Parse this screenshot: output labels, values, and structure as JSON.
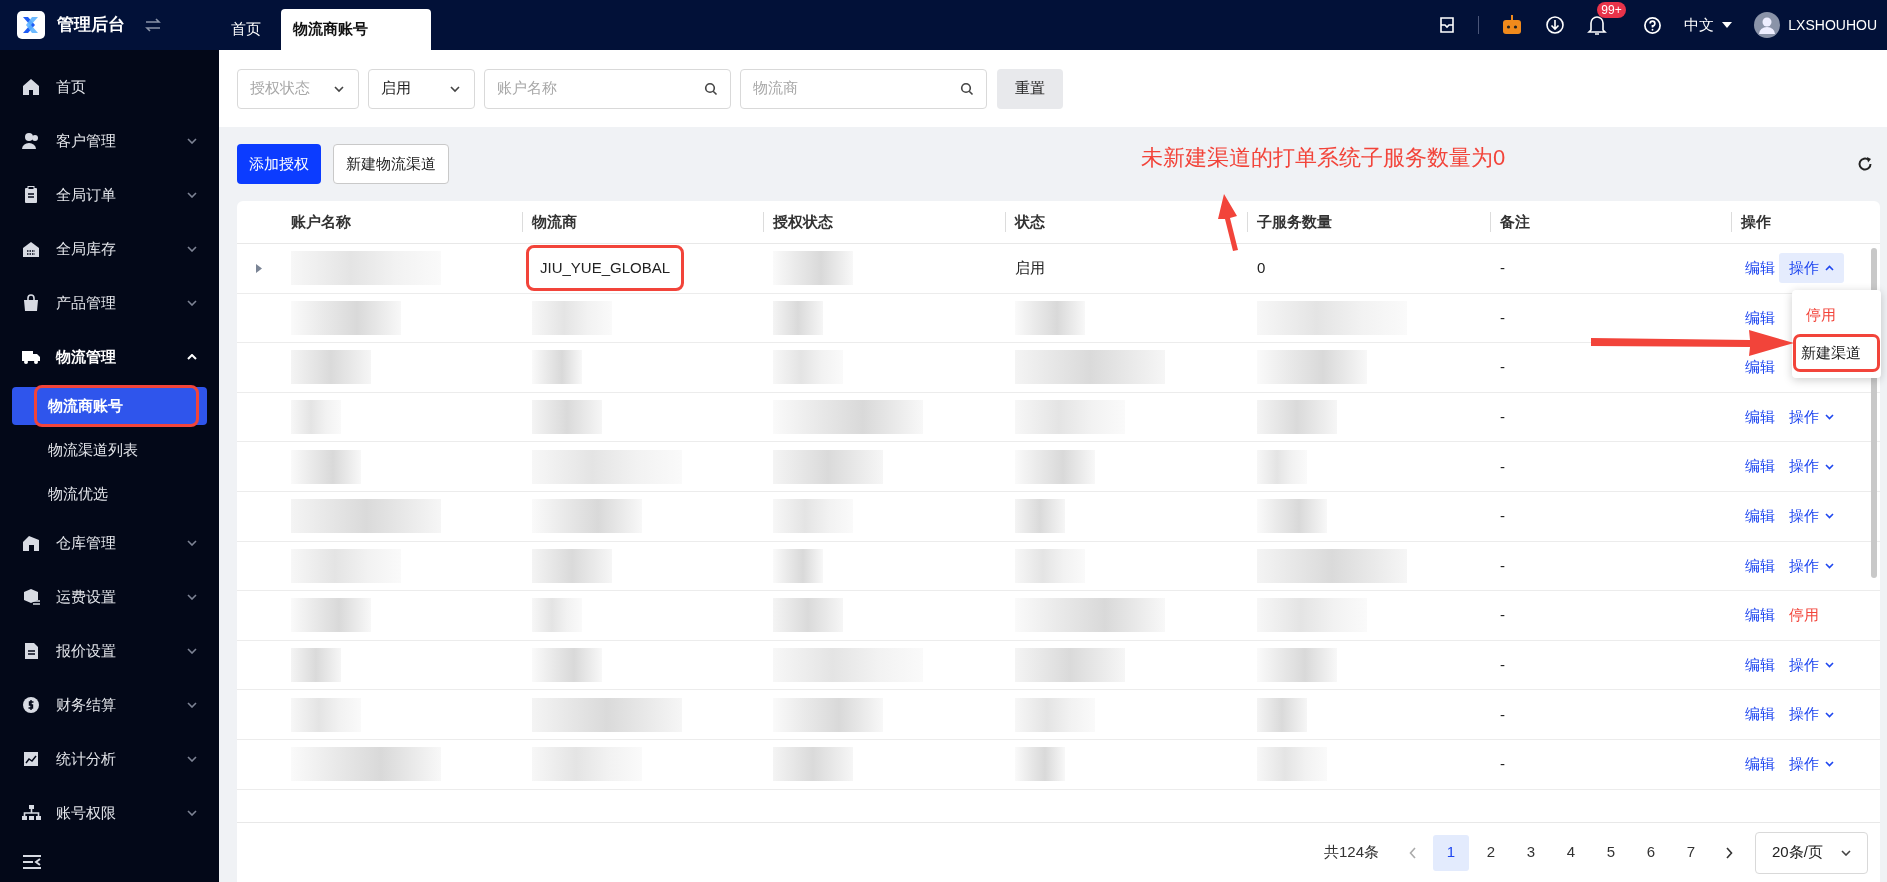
{
  "app_title": "管理后台",
  "top_tabs": [
    {
      "label": "首页",
      "selected": false
    },
    {
      "label": "物流商账号",
      "selected": true
    }
  ],
  "header": {
    "notification_badge": "99+",
    "language": "中文",
    "user": "LXSHOUHOU"
  },
  "sidebar": {
    "items": [
      {
        "kind": "link",
        "label": "首页"
      },
      {
        "kind": "group",
        "label": "客户管理",
        "expanded": false
      },
      {
        "kind": "group",
        "label": "全局订单",
        "expanded": false
      },
      {
        "kind": "group",
        "label": "全局库存",
        "expanded": false
      },
      {
        "kind": "group",
        "label": "产品管理",
        "expanded": false
      },
      {
        "kind": "group",
        "label": "物流管理",
        "expanded": true,
        "children": [
          {
            "label": "物流商账号",
            "selected": true,
            "highlighted": true
          },
          {
            "label": "物流渠道列表",
            "selected": false,
            "highlighted": false
          },
          {
            "label": "物流优选",
            "selected": false,
            "highlighted": false
          }
        ]
      },
      {
        "kind": "group",
        "label": "仓库管理",
        "expanded": false
      },
      {
        "kind": "group",
        "label": "运费设置",
        "expanded": false
      },
      {
        "kind": "group",
        "label": "报价设置",
        "expanded": false
      },
      {
        "kind": "group",
        "label": "财务结算",
        "expanded": false
      },
      {
        "kind": "group",
        "label": "统计分析",
        "expanded": false
      },
      {
        "kind": "group",
        "label": "账号权限",
        "expanded": false
      }
    ]
  },
  "filters": [
    {
      "kind": "select",
      "placeholder": "授权状态"
    },
    {
      "kind": "select",
      "value": "启用"
    },
    {
      "kind": "search",
      "placeholder": "账户名称"
    },
    {
      "kind": "search",
      "placeholder": "物流商"
    }
  ],
  "reset_button": "重置",
  "toolbar_buttons": [
    {
      "label": "添加授权",
      "primary": true
    },
    {
      "label": "新建物流渠道",
      "primary": false
    }
  ],
  "annotation": {
    "text": "未新建渠道的打单系统子服务数量为0"
  },
  "table": {
    "columns": [
      "账户名称",
      "物流商",
      "授权状态",
      "状态",
      "子服务数量",
      "备注",
      "操作"
    ],
    "rows": [
      {
        "expandable": true,
        "cells": [
          {
            "kind": "blurred"
          },
          {
            "kind": "text",
            "text": "JIU_YUE_GLOBAL",
            "highlighted": true
          },
          {
            "kind": "blurred"
          },
          {
            "kind": "text",
            "text": "启用"
          },
          {
            "kind": "text",
            "text": "0"
          }
        ],
        "remark": "-",
        "actions": [
          {
            "kind": "link",
            "label": "编辑"
          },
          {
            "kind": "menu",
            "label": "操作",
            "expanded": true
          }
        ]
      },
      {
        "expandable": false,
        "cells": [
          {
            "kind": "blurred"
          },
          {
            "kind": "blurred"
          },
          {
            "kind": "blurred"
          },
          {
            "kind": "blurred"
          },
          {
            "kind": "blurred"
          }
        ],
        "remark": "-",
        "actions": [
          {
            "kind": "link",
            "label": "编辑"
          }
        ]
      },
      {
        "expandable": false,
        "cells": [
          {
            "kind": "blurred"
          },
          {
            "kind": "blurred"
          },
          {
            "kind": "blurred"
          },
          {
            "kind": "blurred"
          },
          {
            "kind": "blurred"
          }
        ],
        "remark": "-",
        "actions": [
          {
            "kind": "link",
            "label": "编辑"
          }
        ]
      },
      {
        "expandable": false,
        "cells": [
          {
            "kind": "blurred"
          },
          {
            "kind": "blurred"
          },
          {
            "kind": "blurred"
          },
          {
            "kind": "blurred"
          },
          {
            "kind": "blurred"
          }
        ],
        "remark": "-",
        "actions": [
          {
            "kind": "link",
            "label": "编辑"
          },
          {
            "kind": "menu",
            "label": "操作",
            "expanded": false
          }
        ]
      },
      {
        "expandable": false,
        "cells": [
          {
            "kind": "blurred"
          },
          {
            "kind": "blurred"
          },
          {
            "kind": "blurred"
          },
          {
            "kind": "blurred"
          },
          {
            "kind": "blurred"
          }
        ],
        "remark": "-",
        "actions": [
          {
            "kind": "link",
            "label": "编辑"
          },
          {
            "kind": "menu",
            "label": "操作",
            "expanded": false
          }
        ]
      },
      {
        "expandable": false,
        "cells": [
          {
            "kind": "blurred"
          },
          {
            "kind": "blurred"
          },
          {
            "kind": "blurred"
          },
          {
            "kind": "blurred"
          },
          {
            "kind": "blurred"
          }
        ],
        "remark": "-",
        "actions": [
          {
            "kind": "link",
            "label": "编辑"
          },
          {
            "kind": "menu",
            "label": "操作",
            "expanded": false
          }
        ]
      },
      {
        "expandable": false,
        "cells": [
          {
            "kind": "blurred"
          },
          {
            "kind": "blurred"
          },
          {
            "kind": "blurred"
          },
          {
            "kind": "blurred"
          },
          {
            "kind": "blurred"
          }
        ],
        "remark": "-",
        "actions": [
          {
            "kind": "link",
            "label": "编辑"
          },
          {
            "kind": "menu",
            "label": "操作",
            "expanded": false
          }
        ]
      },
      {
        "expandable": false,
        "cells": [
          {
            "kind": "blurred"
          },
          {
            "kind": "blurred"
          },
          {
            "kind": "blurred"
          },
          {
            "kind": "blurred"
          },
          {
            "kind": "blurred"
          }
        ],
        "remark": "-",
        "actions": [
          {
            "kind": "link",
            "label": "编辑"
          },
          {
            "kind": "danger",
            "label": "停用"
          }
        ]
      },
      {
        "expandable": false,
        "cells": [
          {
            "kind": "blurred"
          },
          {
            "kind": "blurred"
          },
          {
            "kind": "blurred"
          },
          {
            "kind": "blurred"
          },
          {
            "kind": "blurred"
          }
        ],
        "remark": "-",
        "actions": [
          {
            "kind": "link",
            "label": "编辑"
          },
          {
            "kind": "menu",
            "label": "操作",
            "expanded": false
          }
        ]
      },
      {
        "expandable": false,
        "cells": [
          {
            "kind": "blurred"
          },
          {
            "kind": "blurred"
          },
          {
            "kind": "blurred"
          },
          {
            "kind": "blurred"
          },
          {
            "kind": "blurred"
          }
        ],
        "remark": "-",
        "actions": [
          {
            "kind": "link",
            "label": "编辑"
          },
          {
            "kind": "menu",
            "label": "操作",
            "expanded": false
          }
        ]
      },
      {
        "expandable": false,
        "cells": [
          {
            "kind": "blurred"
          },
          {
            "kind": "blurred"
          },
          {
            "kind": "blurred"
          },
          {
            "kind": "blurred"
          },
          {
            "kind": "blurred"
          }
        ],
        "remark": "-",
        "actions": [
          {
            "kind": "link",
            "label": "编辑"
          },
          {
            "kind": "menu",
            "label": "操作",
            "expanded": false
          }
        ]
      }
    ]
  },
  "action_menu": {
    "items": [
      {
        "label": "停用",
        "kind": "danger",
        "highlighted": false
      },
      {
        "label": "新建渠道",
        "kind": "normal",
        "highlighted": true
      }
    ]
  },
  "pagination": {
    "total": "共124条",
    "pages": [
      {
        "label": "1",
        "selected": true
      },
      {
        "label": "2",
        "selected": false
      },
      {
        "label": "3",
        "selected": false
      },
      {
        "label": "4",
        "selected": false
      },
      {
        "label": "5",
        "selected": false
      },
      {
        "label": "6",
        "selected": false
      },
      {
        "label": "7",
        "selected": false
      }
    ],
    "page_size": "20条/页"
  }
}
